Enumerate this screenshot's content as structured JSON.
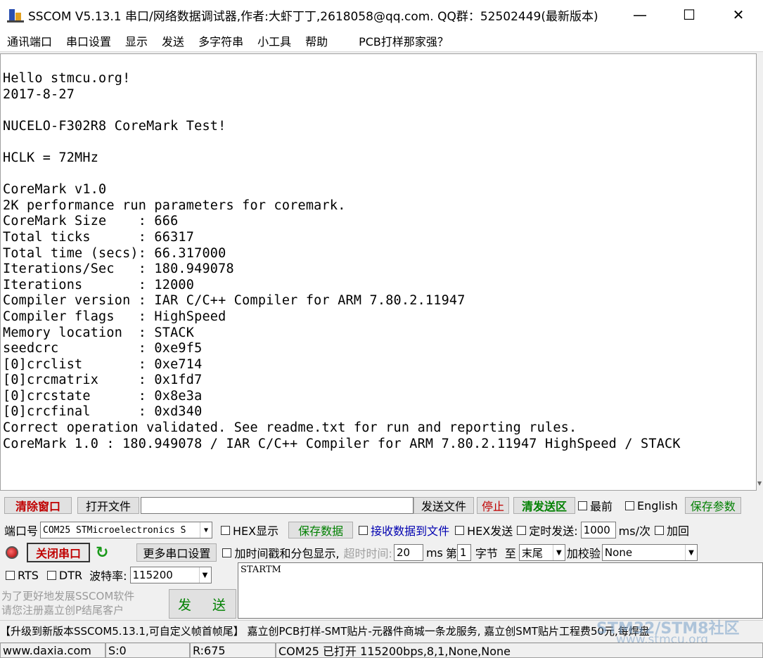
{
  "window": {
    "title": "SSCOM V5.13.1 串口/网络数据调试器,作者:大虾丁丁,2618058@qq.com. QQ群：52502449(最新版本)",
    "minimize": "—",
    "maximize": "☐",
    "close": "✕"
  },
  "menu": [
    "通讯端口",
    "串口设置",
    "显示",
    "发送",
    "多字符串",
    "小工具",
    "帮助",
    "PCB打样那家强？"
  ],
  "receive_text": "Hello stmcu.org!\n2017-8-27\n\nNUCELO-F302R8 CoreMark Test!\n\nHCLK = 72MHz\n\nCoreMark v1.0\n2K performance run parameters for coremark.\nCoreMark Size    : 666\nTotal ticks      : 66317\nTotal time (secs): 66.317000\nIterations/Sec   : 180.949078\nIterations       : 12000\nCompiler version : IAR C/C++ Compiler for ARM 7.80.2.11947\nCompiler flags   : HighSpeed\nMemory location  : STACK\nseedcrc          : 0xe9f5\n[0]crclist       : 0xe714\n[0]crcmatrix     : 0x1fd7\n[0]crcstate      : 0x8e3a\n[0]crcfinal      : 0xd340\nCorrect operation validated. See readme.txt for run and reporting rules.\nCoreMark 1.0 : 180.949078 / IAR C/C++ Compiler for ARM 7.80.2.11947 HighSpeed / STACK",
  "row1": {
    "clear_window": "清除窗口",
    "open_file": "打开文件",
    "file_path": "",
    "send_file": "发送文件",
    "stop": "停止",
    "clear_send": "清发送区",
    "topmost": "最前",
    "english": "English",
    "save_params": "保存参数"
  },
  "row2": {
    "port_label": "端口号",
    "port_value": "COM25 STMicroelectronics S",
    "hex_display": "HEX显示",
    "save_data": "保存数据",
    "recv_to_file": "接收数据到文件",
    "hex_send": "HEX发送",
    "timed_send": "定时发送:",
    "interval": "1000",
    "interval_unit": "ms/次",
    "add": "加回"
  },
  "row3": {
    "close_port": "关闭串口",
    "more_settings": "更多串口设置",
    "timestamp": "加时间戳和分包显示,",
    "timeout_label": "超时时间:",
    "timeout_value": "20",
    "timeout_unit": "ms",
    "nth": "第",
    "byte_index": "1",
    "byte_label": "字节",
    "to_label": "至",
    "end_value": "末尾",
    "checksum_label": "加校验",
    "checksum_value": "None"
  },
  "row4": {
    "rts": "RTS",
    "dtr": "DTR",
    "baud_label": "波特率:",
    "baud_value": "115200"
  },
  "send_text": "STARTM",
  "ad_text": "为了更好地发展SSCOM软件\n请您注册嘉立创P结尾客户",
  "send_button": "发 送",
  "promo_text": "【升级到新版本SSCOM5.13.1,可自定义帧首帧尾】  嘉立创PCB打样-SMT贴片-元器件商城一条龙服务, 嘉立创SMT贴片工程费50元,每焊盘",
  "watermark": "STM32/STM8社区",
  "watermark_url": "www.stmcu.org",
  "status": {
    "site": "www.daxia.com",
    "sent": "S:0",
    "received": "R:675",
    "port_status": "COM25 已打开  115200bps,8,1,None,None"
  },
  "colors": {
    "clear_window": "#c00000",
    "save_params": "#008000",
    "recv_to_file": "#0000b0"
  }
}
